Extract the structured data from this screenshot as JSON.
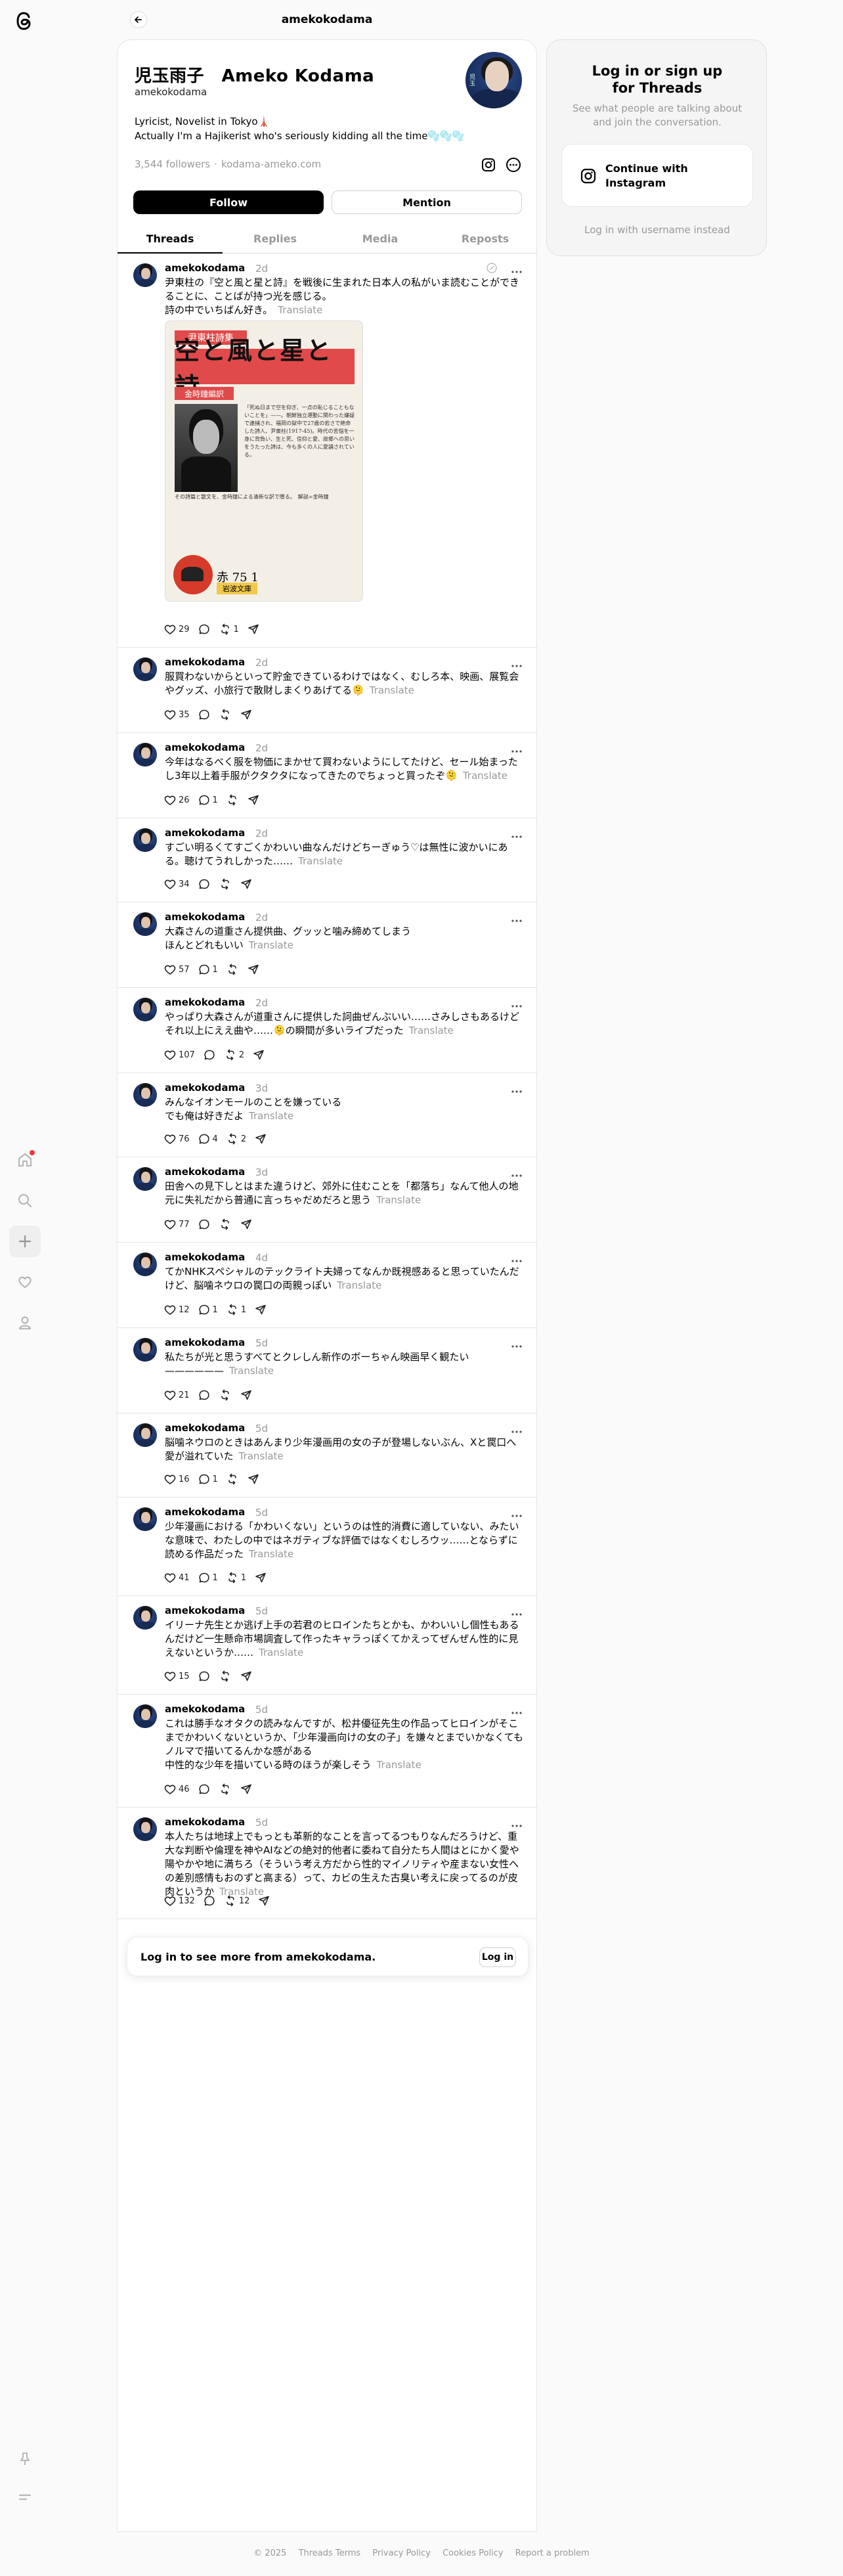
{
  "topbar": {
    "title": "amekokodama"
  },
  "profile": {
    "display_name": "児玉雨子　Ameko Kodama",
    "username": "amekokodama",
    "bio_line1": "Lyricist, Novelist in Tokyo🗼",
    "bio_line2": "Actually I'm a Hajikerist who's seriously kidding all the time🫧🫧🫧",
    "followers": "3,544 followers",
    "link": "kodama-ameko.com",
    "follow_label": "Follow",
    "mention_label": "Mention"
  },
  "tabs": [
    {
      "label": "Threads"
    },
    {
      "label": "Replies"
    },
    {
      "label": "Media"
    },
    {
      "label": "Reposts"
    }
  ],
  "translate_label": "Translate",
  "posts": [
    {
      "user": "amekokodama",
      "time": "2d",
      "text": "尹東柱の『空と風と星と詩』を戦後に生まれた日本人の私がいま読むことができることに、ことばが持つ光を感じる。\n詩の中でいちばん好き。",
      "likes": "29",
      "replies": "",
      "reposts": "1",
      "image": {
        "series": "尹東柱詩集",
        "title": "空と風と星と詩",
        "editor": "金時鐘編訳",
        "desc": "「死ぬ日まで空を仰ぎ、一点の恥じることもないことを」——。朝鮮独立運動に関わった嫌疑で逮捕され、福岡の獄中で27歳の若さで絶命した詩人、尹東柱(1917-45)。時代の苦悩を一身に背負い、生と死、信仰と愛、故郷への思いをうたった詩は、今も多くの人に愛誦されている。",
        "desc2": "その詩篇と散文を、金時鐘による清新な訳で贈る。　解説=金時鐘",
        "number": "赤 75 1",
        "label": "岩波文庫"
      }
    },
    {
      "user": "amekokodama",
      "time": "2d",
      "text": "服買わないからといって貯金できているわけではなく、むしろ本、映画、展覧会やグッズ、小旅行で散財しまくりあげてる🫠",
      "likes": "35",
      "replies": "",
      "reposts": ""
    },
    {
      "user": "amekokodama",
      "time": "2d",
      "text": "今年はなるべく服を物価にまかせて買わないようにしてたけど、セール始まったし3年以上着手服がクタクタになってきたのでちょっと買ったぞ🫠",
      "likes": "26",
      "replies": "1",
      "reposts": ""
    },
    {
      "user": "amekokodama",
      "time": "2d",
      "text": "すごい明るくてすごくかわいい曲なんだけどちーぎゅう♡は無性に波かいにある。聴けてうれしかった……",
      "likes": "34",
      "replies": "",
      "reposts": ""
    },
    {
      "user": "amekokodama",
      "time": "2d",
      "text": "大森さんの道重さん提供曲、グッッと噛み締めてしまう\nほんとどれもいい",
      "likes": "57",
      "replies": "1",
      "reposts": ""
    },
    {
      "user": "amekokodama",
      "time": "2d",
      "text": "やっぱり大森さんが道重さんに提供した詞曲ぜんぶいい……さみしさもあるけどそれ以上にええ曲や……🫠の瞬間が多いライブだった",
      "likes": "107",
      "replies": "",
      "reposts": "2"
    },
    {
      "user": "amekokodama",
      "time": "3d",
      "text": "みんなイオンモールのことを嫌っている\nでも俺は好きだよ",
      "likes": "76",
      "replies": "4",
      "reposts": "2"
    },
    {
      "user": "amekokodama",
      "time": "3d",
      "text": "田舎への見下しとはまた違うけど、郊外に住むことを「都落ち」なんて他人の地元に失礼だから普通に言っちゃだめだろと思う",
      "likes": "77",
      "replies": "",
      "reposts": ""
    },
    {
      "user": "amekokodama",
      "time": "4d",
      "text": "てかNHKスペシャルのテックライト夫婦ってなんか既視感あると思っていたんだけど、脳噛ネウロの罠口の両親っぽい",
      "likes": "12",
      "replies": "1",
      "reposts": "1"
    },
    {
      "user": "amekokodama",
      "time": "5d",
      "text": "私たちが光と思うすべてとクレしん新作のボーちゃん映画早く観たい——————",
      "likes": "21",
      "replies": "",
      "reposts": ""
    },
    {
      "user": "amekokodama",
      "time": "5d",
      "text": "脳噛ネウロのときはあんまり少年漫画用の女の子が登場しないぶん、Xと罠口へ愛が溢れていた",
      "likes": "16",
      "replies": "1",
      "reposts": ""
    },
    {
      "user": "amekokodama",
      "time": "5d",
      "text": "少年漫画における「かわいくない」というのは性的消費に適していない、みたいな意味で、わたしの中ではネガティブな評価ではなくむしろウッ……とならずに読める作品だった",
      "likes": "41",
      "replies": "1",
      "reposts": "1"
    },
    {
      "user": "amekokodama",
      "time": "5d",
      "text": "イリーナ先生とか逃げ上手の若君のヒロインたちとかも、かわいいし個性もあるんだけど一生懸命市場調査して作ったキャラっぽくてかえってぜんぜん性的に見えないというか……",
      "likes": "15",
      "replies": "",
      "reposts": ""
    },
    {
      "user": "amekokodama",
      "time": "5d",
      "text": "これは勝手なオタクの読みなんですが、松井優征先生の作品ってヒロインがそこまでかわいくないというか、「少年漫画向けの女の子」を嫌々とまでいかなくてもノルマで描いてるんかな感がある\n中性的な少年を描いている時のほうが楽しそう",
      "likes": "46",
      "replies": "",
      "reposts": ""
    },
    {
      "user": "amekokodama",
      "time": "5d",
      "text": "本人たちは地球上でもっとも革新的なことを言ってるつもりなんだろうけど、重大な判断や倫理を神やAIなどの絶対的他者に委ねて自分たち人間はとにかく愛や陽やかや地に満ちろ（そういう考え方だから性的マイノリティや産まない女性への差別感情もおのずと高まる）って、カビの生えた古臭い考えに戻ってるのが皮肉というか",
      "likes": "132",
      "replies": "",
      "reposts": "12"
    }
  ],
  "login_more": {
    "text": "Log in to see more from amekokodama.",
    "button": "Log in"
  },
  "side_card": {
    "title": "Log in or sign up\nfor Threads",
    "subtitle": "See what people are talking about and join the conversation.",
    "continue_label": "Continue with\nInstagram",
    "username_login": "Log in with username instead"
  },
  "footer": [
    "© 2025",
    "Threads Terms",
    "Privacy Policy",
    "Cookies Policy",
    "Report a problem"
  ],
  "icons": {
    "rail": [
      "threads-logo-icon",
      "home-icon",
      "search-icon",
      "create-icon",
      "heart-icon",
      "profile-icon",
      "pin-icon",
      "menu-icon"
    ],
    "notification_color": "#ff3040"
  }
}
